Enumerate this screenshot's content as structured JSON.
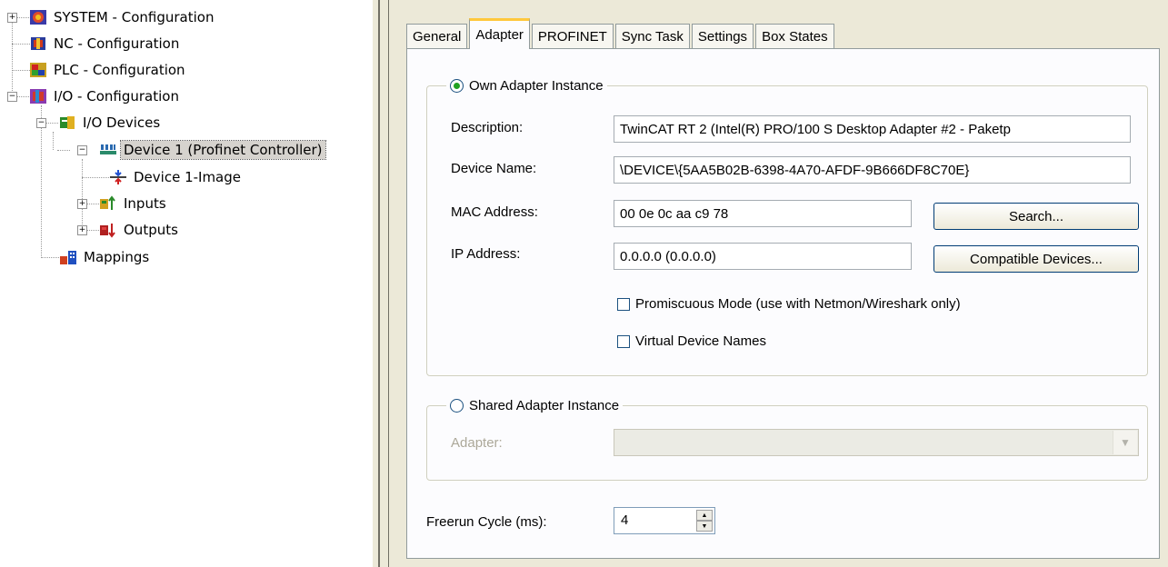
{
  "tree": {
    "system": "SYSTEM - Configuration",
    "nc": "NC - Configuration",
    "plc": "PLC - Configuration",
    "io": "I/O - Configuration",
    "io_devices": "I/O Devices",
    "device1": "Device 1 (Profinet Controller)",
    "device1_image": "Device 1-Image",
    "inputs": "Inputs",
    "outputs": "Outputs",
    "mappings": "Mappings"
  },
  "tabs": [
    "General",
    "Adapter",
    "PROFINET",
    "Sync Task",
    "Settings",
    "Box States"
  ],
  "active_tab": "Adapter",
  "own": {
    "title": "Own Adapter Instance",
    "description_label": "Description:",
    "description_value": "TwinCAT RT 2 (Intel(R) PRO/100 S Desktop Adapter #2 - Paketp",
    "device_name_label": "Device Name:",
    "device_name_value": "\\DEVICE\\{5AA5B02B-6398-4A70-AFDF-9B666DF8C70E}",
    "mac_label": "MAC Address:",
    "mac_value": "00 0e 0c aa c9 78",
    "search_button": "Search...",
    "ip_label": "IP Address:",
    "ip_value": "0.0.0.0 (0.0.0.0)",
    "compatible_button": "Compatible Devices...",
    "promiscuous": "Promiscuous Mode (use with Netmon/Wireshark only)",
    "virtual_names": "Virtual Device Names"
  },
  "shared": {
    "title": "Shared Adapter Instance",
    "adapter_label": "Adapter:",
    "adapter_value": ""
  },
  "freerun": {
    "label": "Freerun Cycle (ms):",
    "value": "4"
  }
}
